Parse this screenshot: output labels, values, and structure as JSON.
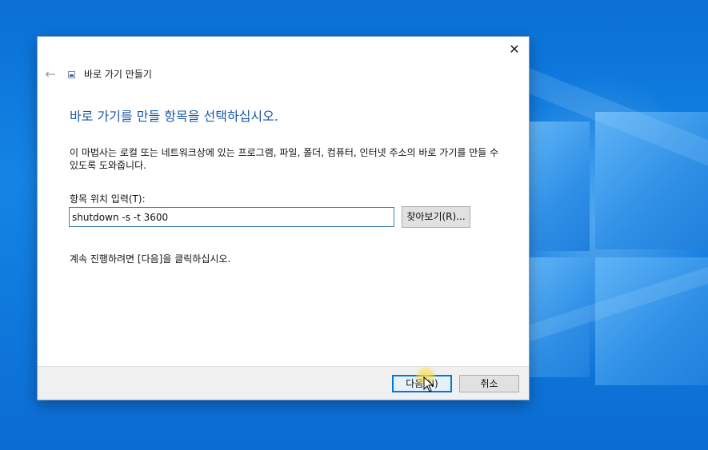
{
  "dialog": {
    "title": "바로 가기 만들기",
    "heading": "바로 가기를 만들 항목을 선택하십시오.",
    "description": "이 마법사는 로컬 또는 네트워크상에 있는 프로그램, 파일, 폴더, 컴퓨터, 인터넷 주소의 바로 가기를 만들 수 있도록 도와줍니다.",
    "field_label": "항목 위치 입력(T):",
    "location_value": "shutdown -s -t 3600",
    "browse_label": "찾아보기(R)...",
    "continue_text": "계속 진행하려면 [다음]을 클릭하십시오.",
    "next_label": "다음(N)",
    "cancel_label": "취소"
  },
  "icons": {
    "close": "close-icon",
    "back": "back-arrow-icon",
    "title": "shortcut-icon",
    "cursor": "mouse-pointer-icon"
  },
  "colors": {
    "heading": "#1b5aa6",
    "desktop": "#0b6cd3",
    "default_button_border": "#0078d7"
  }
}
